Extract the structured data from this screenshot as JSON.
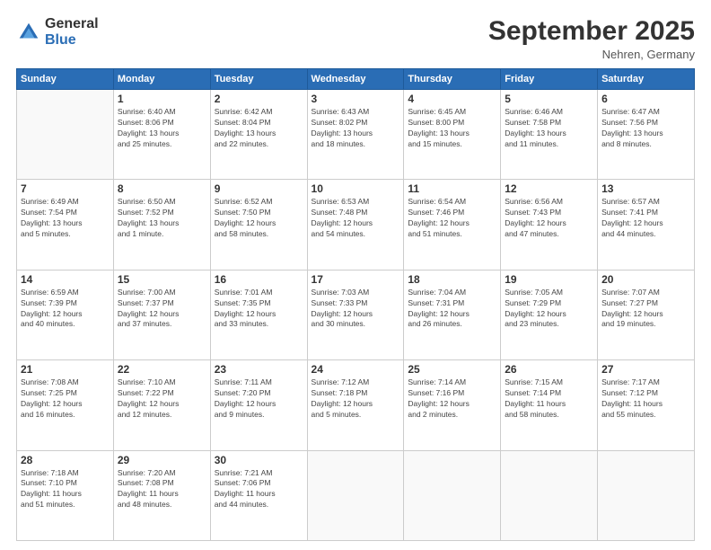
{
  "logo": {
    "general": "General",
    "blue": "Blue"
  },
  "header": {
    "month_year": "September 2025",
    "location": "Nehren, Germany"
  },
  "weekdays": [
    "Sunday",
    "Monday",
    "Tuesday",
    "Wednesday",
    "Thursday",
    "Friday",
    "Saturday"
  ],
  "weeks": [
    [
      {
        "day": "",
        "info": ""
      },
      {
        "day": "1",
        "info": "Sunrise: 6:40 AM\nSunset: 8:06 PM\nDaylight: 13 hours\nand 25 minutes."
      },
      {
        "day": "2",
        "info": "Sunrise: 6:42 AM\nSunset: 8:04 PM\nDaylight: 13 hours\nand 22 minutes."
      },
      {
        "day": "3",
        "info": "Sunrise: 6:43 AM\nSunset: 8:02 PM\nDaylight: 13 hours\nand 18 minutes."
      },
      {
        "day": "4",
        "info": "Sunrise: 6:45 AM\nSunset: 8:00 PM\nDaylight: 13 hours\nand 15 minutes."
      },
      {
        "day": "5",
        "info": "Sunrise: 6:46 AM\nSunset: 7:58 PM\nDaylight: 13 hours\nand 11 minutes."
      },
      {
        "day": "6",
        "info": "Sunrise: 6:47 AM\nSunset: 7:56 PM\nDaylight: 13 hours\nand 8 minutes."
      }
    ],
    [
      {
        "day": "7",
        "info": "Sunrise: 6:49 AM\nSunset: 7:54 PM\nDaylight: 13 hours\nand 5 minutes."
      },
      {
        "day": "8",
        "info": "Sunrise: 6:50 AM\nSunset: 7:52 PM\nDaylight: 13 hours\nand 1 minute."
      },
      {
        "day": "9",
        "info": "Sunrise: 6:52 AM\nSunset: 7:50 PM\nDaylight: 12 hours\nand 58 minutes."
      },
      {
        "day": "10",
        "info": "Sunrise: 6:53 AM\nSunset: 7:48 PM\nDaylight: 12 hours\nand 54 minutes."
      },
      {
        "day": "11",
        "info": "Sunrise: 6:54 AM\nSunset: 7:46 PM\nDaylight: 12 hours\nand 51 minutes."
      },
      {
        "day": "12",
        "info": "Sunrise: 6:56 AM\nSunset: 7:43 PM\nDaylight: 12 hours\nand 47 minutes."
      },
      {
        "day": "13",
        "info": "Sunrise: 6:57 AM\nSunset: 7:41 PM\nDaylight: 12 hours\nand 44 minutes."
      }
    ],
    [
      {
        "day": "14",
        "info": "Sunrise: 6:59 AM\nSunset: 7:39 PM\nDaylight: 12 hours\nand 40 minutes."
      },
      {
        "day": "15",
        "info": "Sunrise: 7:00 AM\nSunset: 7:37 PM\nDaylight: 12 hours\nand 37 minutes."
      },
      {
        "day": "16",
        "info": "Sunrise: 7:01 AM\nSunset: 7:35 PM\nDaylight: 12 hours\nand 33 minutes."
      },
      {
        "day": "17",
        "info": "Sunrise: 7:03 AM\nSunset: 7:33 PM\nDaylight: 12 hours\nand 30 minutes."
      },
      {
        "day": "18",
        "info": "Sunrise: 7:04 AM\nSunset: 7:31 PM\nDaylight: 12 hours\nand 26 minutes."
      },
      {
        "day": "19",
        "info": "Sunrise: 7:05 AM\nSunset: 7:29 PM\nDaylight: 12 hours\nand 23 minutes."
      },
      {
        "day": "20",
        "info": "Sunrise: 7:07 AM\nSunset: 7:27 PM\nDaylight: 12 hours\nand 19 minutes."
      }
    ],
    [
      {
        "day": "21",
        "info": "Sunrise: 7:08 AM\nSunset: 7:25 PM\nDaylight: 12 hours\nand 16 minutes."
      },
      {
        "day": "22",
        "info": "Sunrise: 7:10 AM\nSunset: 7:22 PM\nDaylight: 12 hours\nand 12 minutes."
      },
      {
        "day": "23",
        "info": "Sunrise: 7:11 AM\nSunset: 7:20 PM\nDaylight: 12 hours\nand 9 minutes."
      },
      {
        "day": "24",
        "info": "Sunrise: 7:12 AM\nSunset: 7:18 PM\nDaylight: 12 hours\nand 5 minutes."
      },
      {
        "day": "25",
        "info": "Sunrise: 7:14 AM\nSunset: 7:16 PM\nDaylight: 12 hours\nand 2 minutes."
      },
      {
        "day": "26",
        "info": "Sunrise: 7:15 AM\nSunset: 7:14 PM\nDaylight: 11 hours\nand 58 minutes."
      },
      {
        "day": "27",
        "info": "Sunrise: 7:17 AM\nSunset: 7:12 PM\nDaylight: 11 hours\nand 55 minutes."
      }
    ],
    [
      {
        "day": "28",
        "info": "Sunrise: 7:18 AM\nSunset: 7:10 PM\nDaylight: 11 hours\nand 51 minutes."
      },
      {
        "day": "29",
        "info": "Sunrise: 7:20 AM\nSunset: 7:08 PM\nDaylight: 11 hours\nand 48 minutes."
      },
      {
        "day": "30",
        "info": "Sunrise: 7:21 AM\nSunset: 7:06 PM\nDaylight: 11 hours\nand 44 minutes."
      },
      {
        "day": "",
        "info": ""
      },
      {
        "day": "",
        "info": ""
      },
      {
        "day": "",
        "info": ""
      },
      {
        "day": "",
        "info": ""
      }
    ]
  ]
}
